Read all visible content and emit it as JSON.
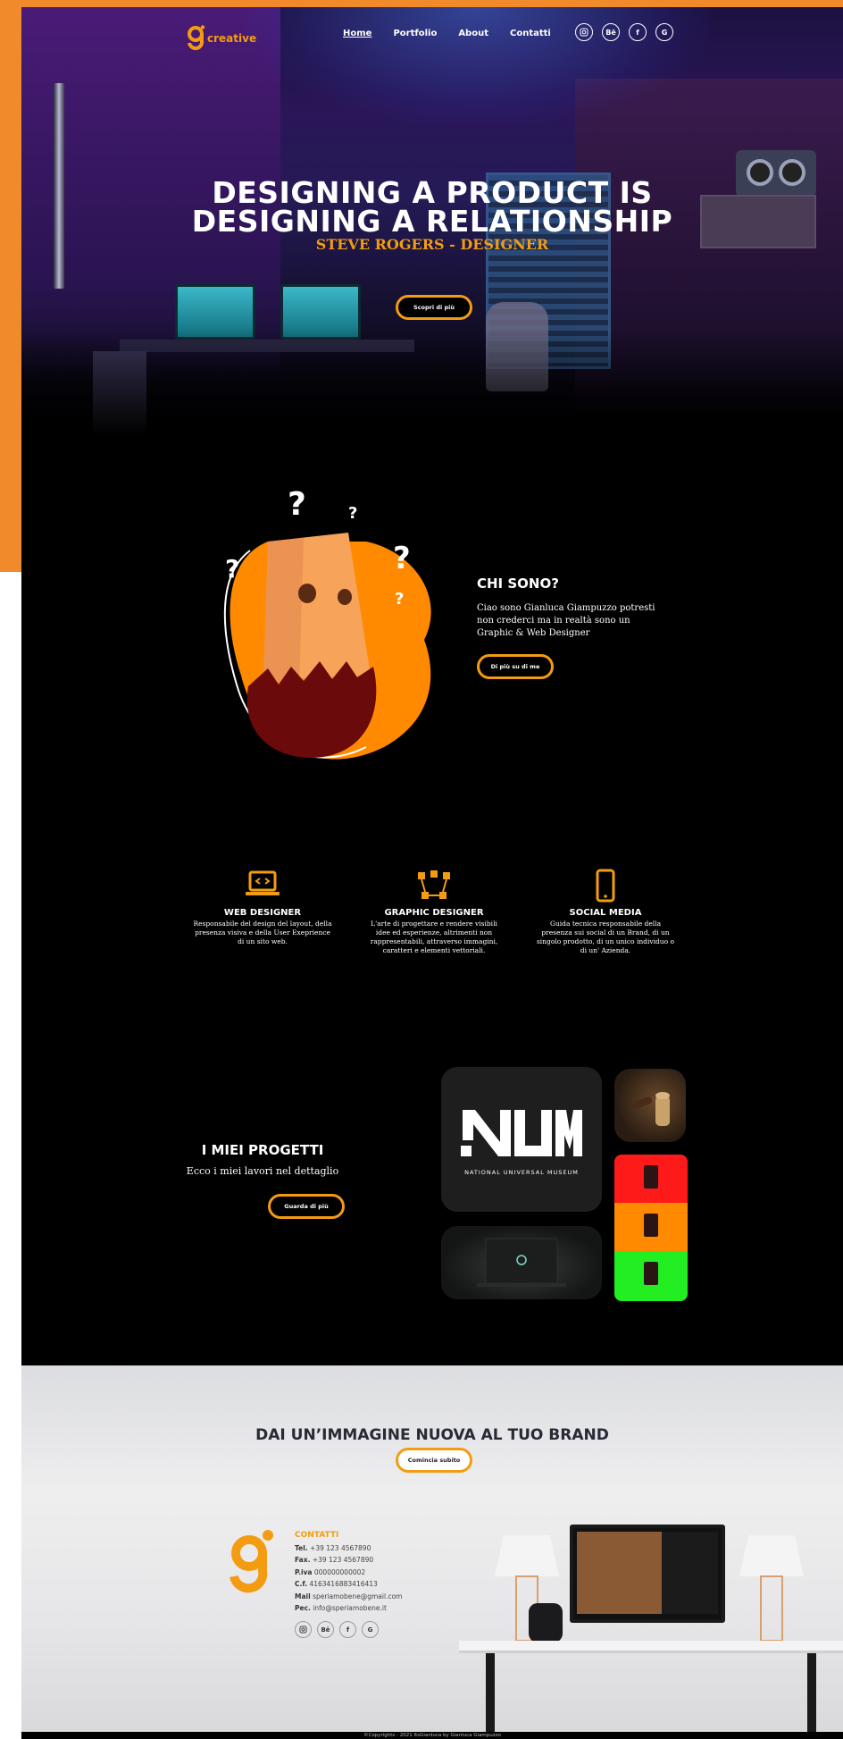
{
  "brand": {
    "logo_text": "creative",
    "accent": "#f39c12"
  },
  "nav": {
    "links": [
      "Home",
      "Portfolio",
      "About",
      "Contatti"
    ],
    "social": [
      "IG",
      "Bē",
      "f",
      "G"
    ]
  },
  "hero": {
    "title_line1": "DESIGNING A PRODUCT IS",
    "title_line2": "DESIGNING A RELATIONSHIP",
    "subtitle": "STEVE ROGERS - DESIGNER",
    "button": "Scopri di più"
  },
  "about": {
    "title": "CHI SONO?",
    "text": "Ciao sono Gianluca Giampuzzo potresti non crederci ma in realtà sono un Graphic & Web Designer",
    "button": "Di più su di me"
  },
  "services": [
    {
      "title": "WEB DESIGNER",
      "desc": "Responsabile del design del layout, della presenza visiva e della  User Exeprience di un sito web.",
      "icon": "laptop-code-icon"
    },
    {
      "title": "GRAPHIC DESIGNER",
      "desc": "L'arte di progettare e rendere visibili idee ed esperienze, altrimenti non rappresentabili, attraverso immagini, caratteri e elementi vettoriali.",
      "icon": "vector-nodes-icon"
    },
    {
      "title": "SOCIAL MEDIA",
      "desc": "Guida tecnica responsabile della presenza sui social di un Brand, di un singolo prodotto, di un unico individuo o di un' Azienda.",
      "icon": "smartphone-icon"
    }
  ],
  "projects": {
    "title": "I MIEI PROGETTI",
    "subtitle": "Ecco i miei lavori nel dettaglio",
    "button": "Guarda di più",
    "num_caption": "NATIONAL UNIVERSAL MUSEUM"
  },
  "cta": {
    "title": "DAI UN’IMMAGINE NUOVA AL TUO BRAND",
    "button": "Comincia subito"
  },
  "contact": {
    "title": "CONTATTI",
    "rows": [
      {
        "label": "Tel.",
        "value": "+39 123 4567890"
      },
      {
        "label": "Fax.",
        "value": "+39 123 4567890"
      },
      {
        "label": "P.iva",
        "value": "000000000002"
      },
      {
        "label": "C.f.",
        "value": "4163416883416413"
      },
      {
        "label": "Mail",
        "value": "speriamobene@gmail.com"
      },
      {
        "label": "Pec.",
        "value": "info@speriamobene.it"
      }
    ]
  },
  "footer": {
    "text": "©Copyrights - 2021 ItsGianluca by Gianluca Giampuzzo"
  }
}
